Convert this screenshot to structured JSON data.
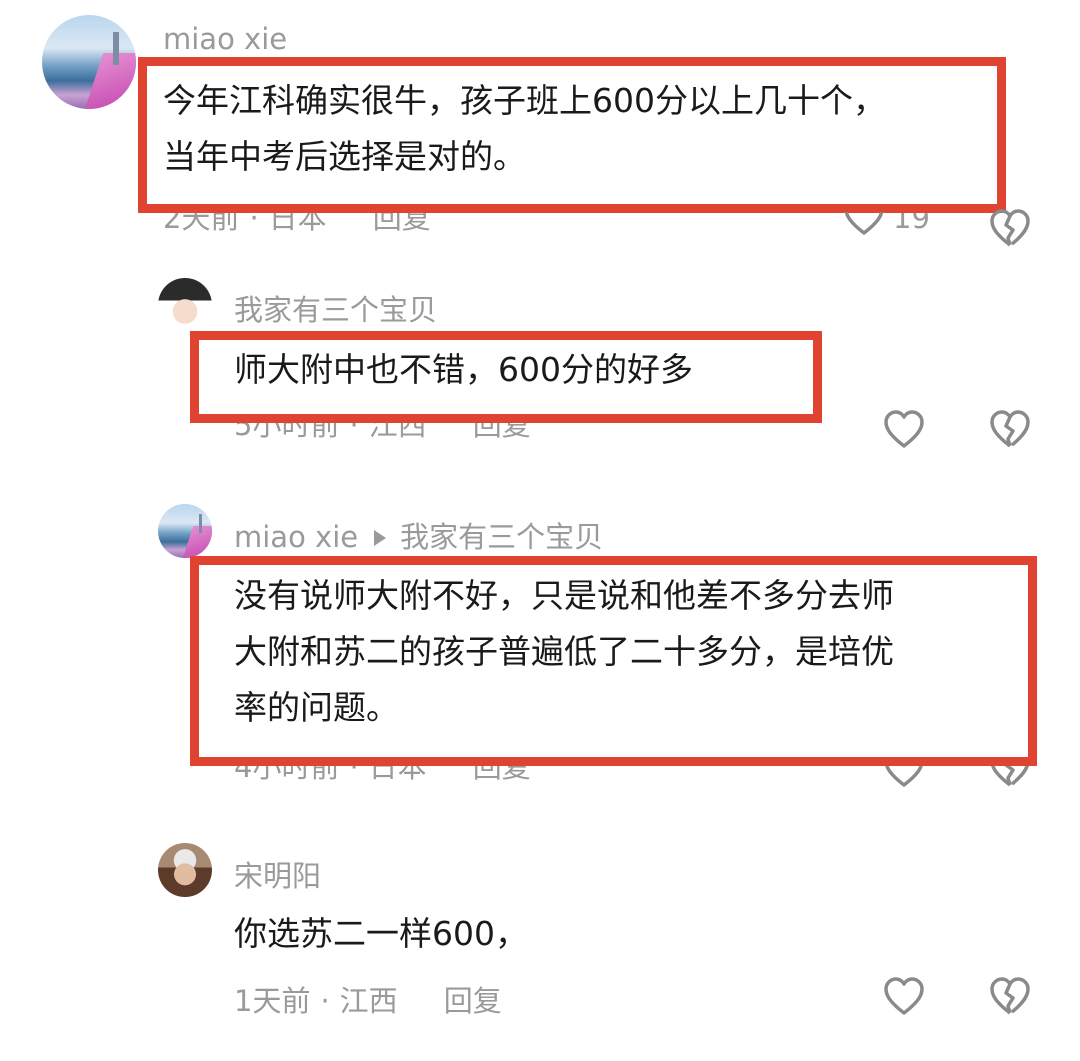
{
  "comments": [
    {
      "username": "miao xie",
      "text_lines": [
        "今年江科确实很牛，孩子班上600分以上几十个，",
        "当年中考后选择是对的。"
      ],
      "time": "2天前",
      "location": "日本",
      "reply_label": "回复",
      "like_count": "19",
      "like_icon": "heart-outline-icon",
      "dislike_icon": "broken-heart-icon"
    },
    {
      "username": "我家有三个宝贝",
      "text_lines": [
        "师大附中也不错，600分的好多"
      ],
      "time": "5小时前",
      "location": "江西",
      "reply_label": "回复",
      "like_icon": "heart-outline-icon",
      "dislike_icon": "broken-heart-icon"
    },
    {
      "username": "miao xie",
      "reply_to": "我家有三个宝贝",
      "text_lines": [
        "没有说师大附不好，只是说和他差不多分去师",
        "大附和苏二的孩子普遍低了二十多分，是培优",
        "率的问题。"
      ],
      "time": "4小时前",
      "location": "日本",
      "reply_label": "回复",
      "like_icon": "heart-outline-icon",
      "dislike_icon": "broken-heart-icon"
    },
    {
      "username": "宋明阳",
      "text_lines": [
        "你选苏二一样600，"
      ],
      "time": "1天前",
      "location": "江西",
      "reply_label": "回复",
      "like_icon": "heart-outline-icon",
      "dislike_icon": "broken-heart-icon"
    }
  ],
  "colors": {
    "highlight_box": "#e0432f",
    "secondary_text": "#9a9a9a",
    "primary_text": "#1a1a1a"
  }
}
